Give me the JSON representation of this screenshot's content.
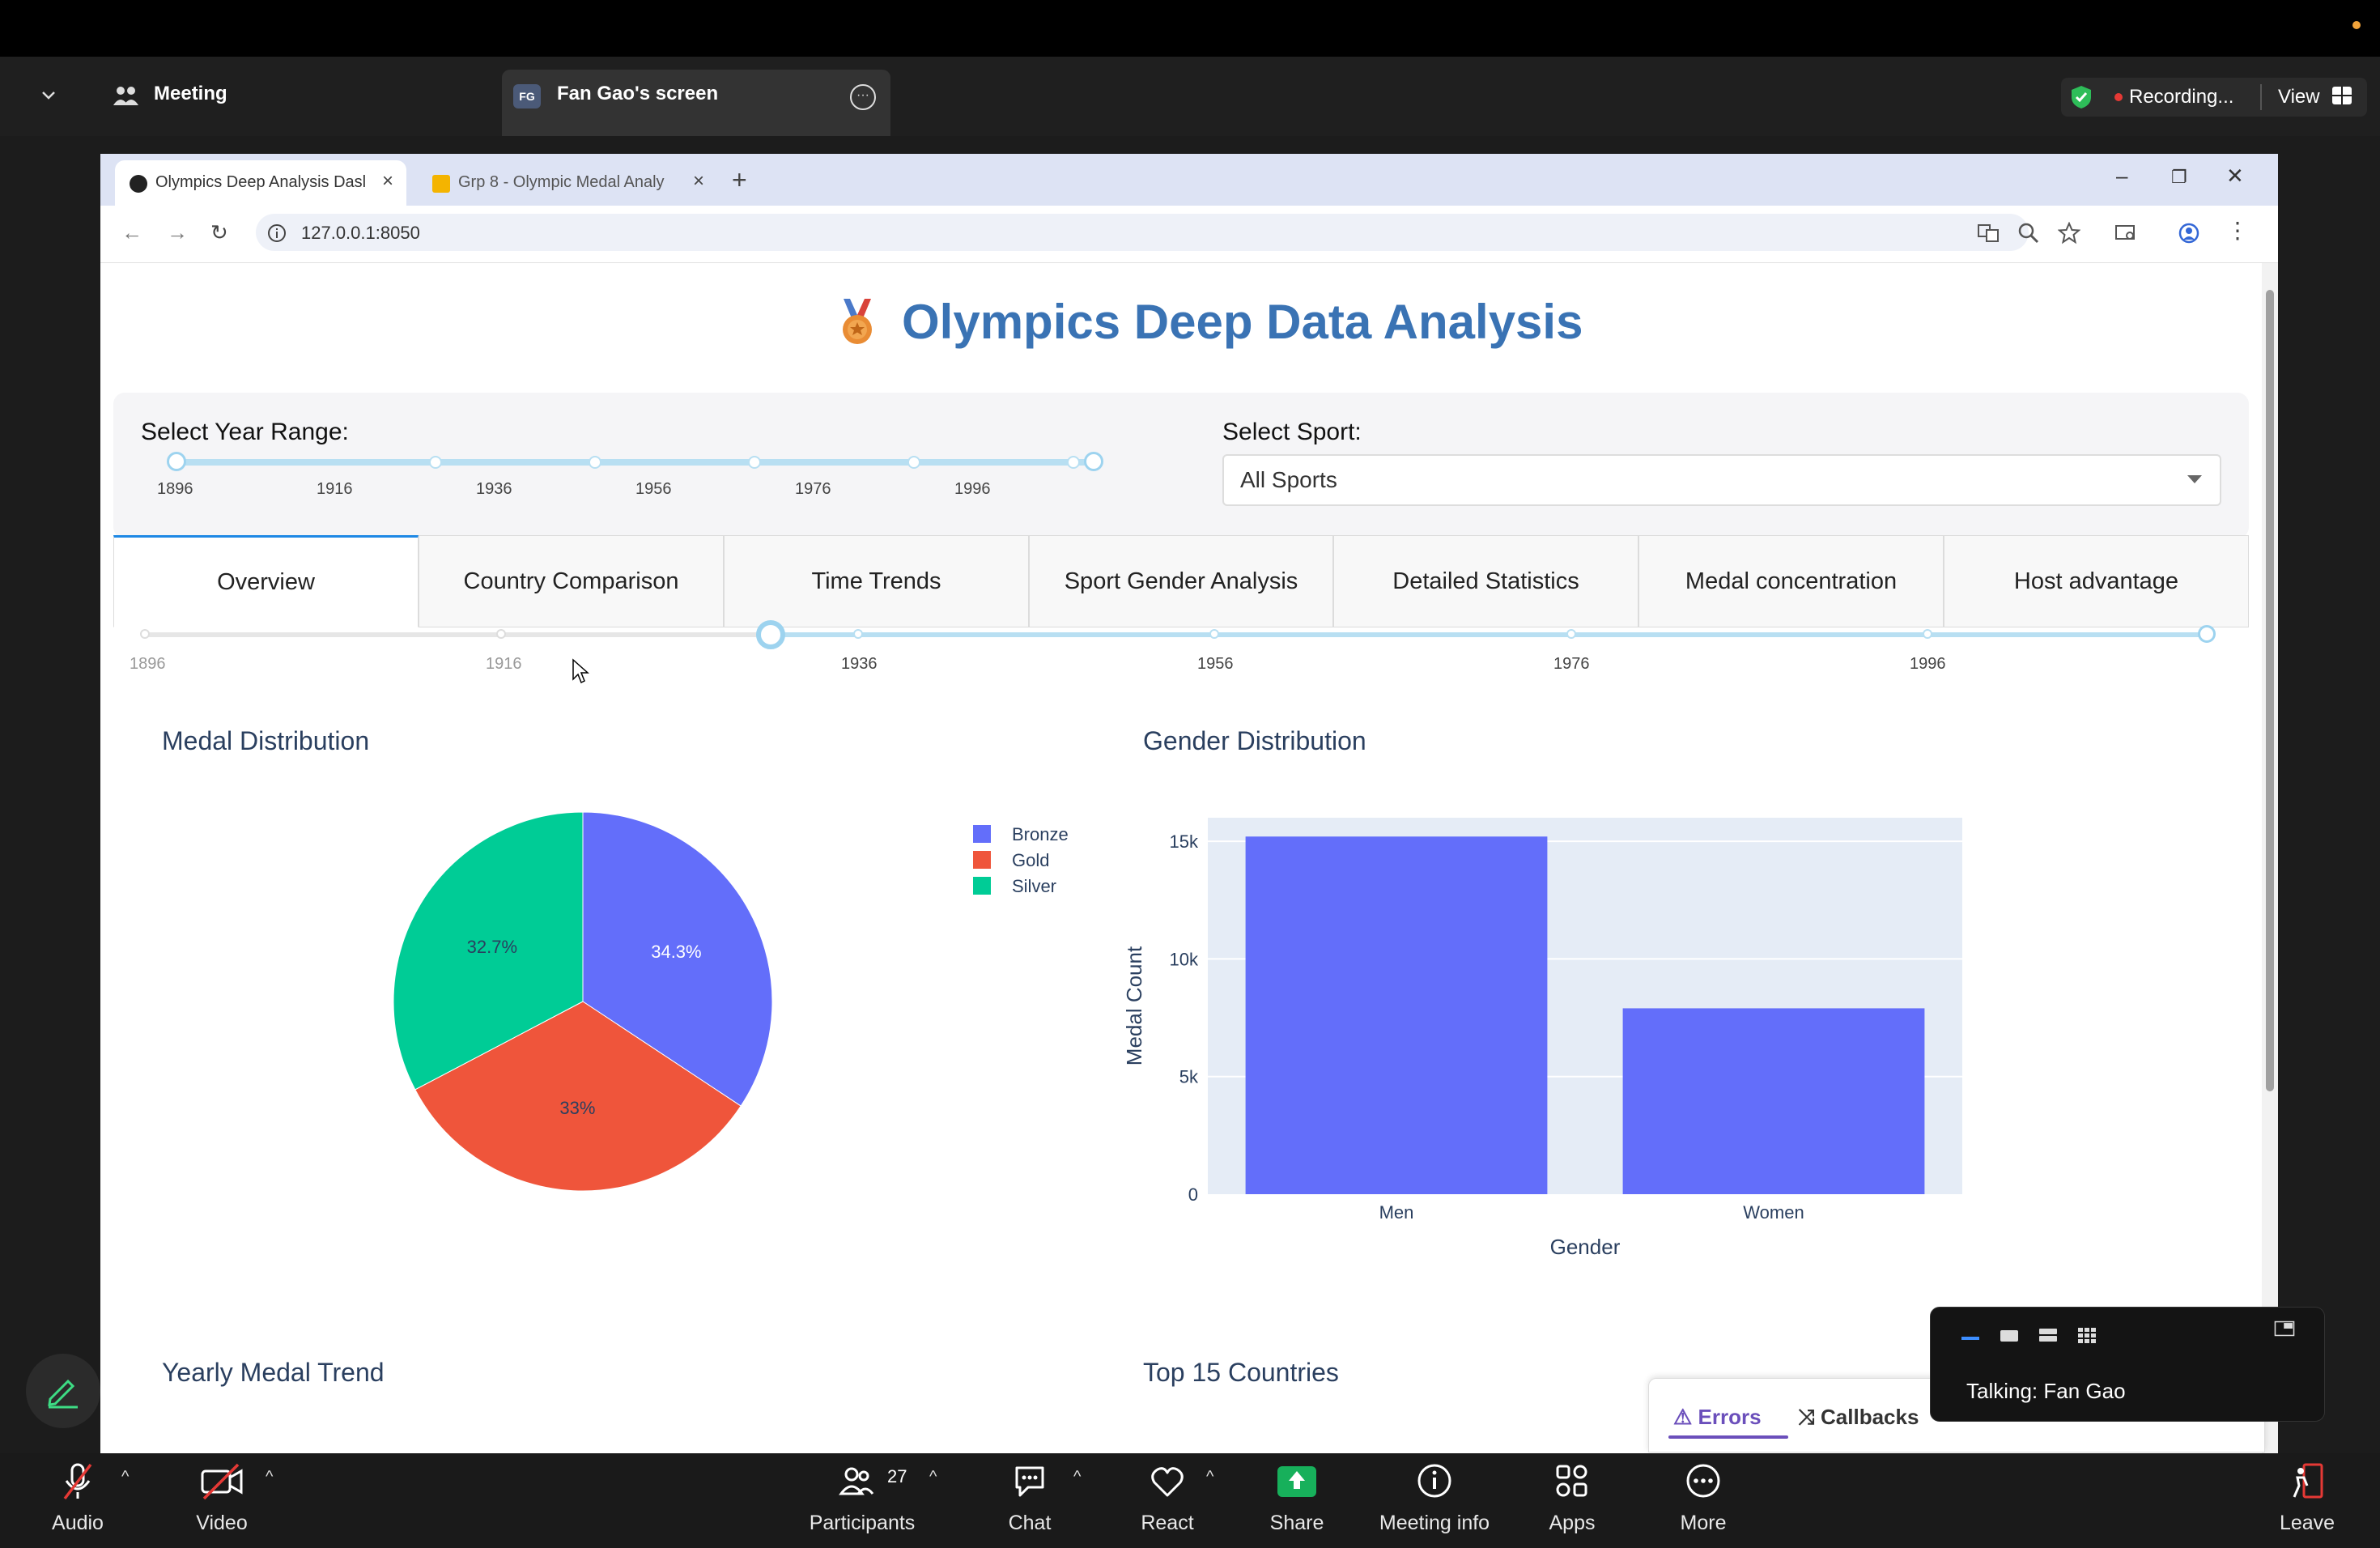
{
  "zoom": {
    "meeting_label": "Meeting",
    "screen_badge": "FG",
    "screen_label": "Fan Gao's screen",
    "recording_label": "Recording...",
    "view_label": "View",
    "talking_label": "Talking: Fan Gao",
    "participants_count": "27",
    "toolbar": {
      "audio": "Audio",
      "video": "Video",
      "participants": "Participants",
      "chat": "Chat",
      "react": "React",
      "share": "Share",
      "meeting_info": "Meeting info",
      "apps": "Apps",
      "more": "More",
      "leave": "Leave"
    }
  },
  "browser": {
    "tabs": [
      {
        "title": "Olympics Deep Analysis Dasl",
        "active": true
      },
      {
        "title": "Grp 8 - Olympic Medal Analy",
        "active": false
      }
    ],
    "url": "127.0.0.1:8050"
  },
  "dashboard": {
    "title": "Olympics Deep Data Analysis",
    "year_range_label": "Select Year Range:",
    "sport_label": "Select Sport:",
    "sport_value": "All Sports",
    "year_ticks": [
      "1896",
      "1916",
      "1936",
      "1956",
      "1976",
      "1996"
    ],
    "year_range_selected": [
      1896,
      2016
    ],
    "tabs": [
      "Overview",
      "Country Comparison",
      "Time Trends",
      "Sport Gender Analysis",
      "Detailed Statistics",
      "Medal concentration",
      "Host advantage"
    ],
    "active_tab": "Overview",
    "slider2_ticks": [
      "1896",
      "1916",
      "1936",
      "1956",
      "1976",
      "1996"
    ],
    "slider2_selected": [
      1931,
      2016
    ],
    "sections": {
      "medal_distribution": "Medal Distribution",
      "gender_distribution": "Gender Distribution",
      "yearly_trend": "Yearly Medal Trend",
      "top_countries": "Top 15 Countries"
    }
  },
  "devtools": {
    "errors": "Errors",
    "callbacks": "Callbacks"
  },
  "colors": {
    "bronze": "#636efa",
    "gold": "#ef553b",
    "silver": "#00cc96",
    "title_blue": "#3a73b4",
    "slider_blue": "#9dd3ef"
  },
  "chart_data": [
    {
      "type": "pie",
      "title": "Medal Distribution",
      "labels": [
        "Bronze",
        "Gold",
        "Silver"
      ],
      "values": [
        34.3,
        33.0,
        32.7
      ],
      "value_labels": [
        "34.3%",
        "33%",
        "32.7%"
      ],
      "colors": [
        "#636efa",
        "#ef553b",
        "#00cc96"
      ],
      "legend": "top-right"
    },
    {
      "type": "bar",
      "title": "Gender Distribution",
      "categories": [
        "Men",
        "Women"
      ],
      "values": [
        15200,
        7900
      ],
      "xlabel": "Gender",
      "ylabel": "Medal Count",
      "ylim": [
        0,
        16000
      ],
      "yticks": [
        0,
        5000,
        10000,
        15000
      ],
      "ytick_labels": [
        "0",
        "5k",
        "10k",
        "15k"
      ],
      "color": "#636efa",
      "grid": true
    }
  ]
}
